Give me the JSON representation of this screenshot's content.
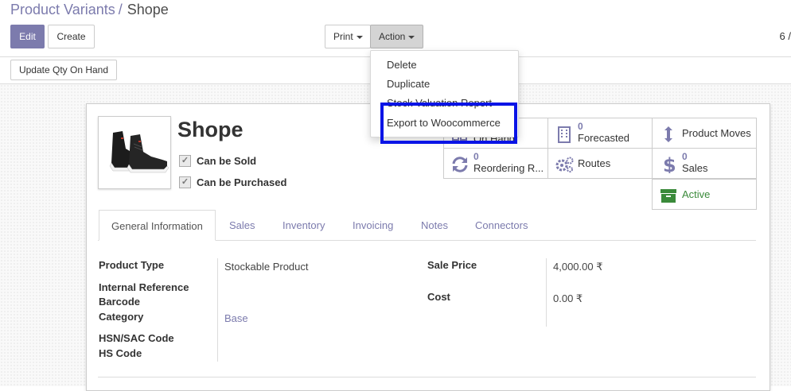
{
  "breadcrumb": {
    "parent": "Product Variants",
    "separator": "/",
    "current": "Shope"
  },
  "buttons": {
    "edit": "Edit",
    "create": "Create",
    "print": "Print",
    "action": "Action",
    "update_qty": "Update Qty On Hand"
  },
  "pager": {
    "text": "6 /"
  },
  "action_menu": {
    "items": [
      "Delete",
      "Duplicate",
      "Stock Valuation Report",
      "Export to Woocommerce"
    ],
    "highlight_color": "#0a14e6"
  },
  "product": {
    "name": "Shope",
    "can_be_sold": "Can be Sold",
    "can_be_purchased": "Can be Purchased",
    "image_icon": "sneaker-image"
  },
  "smart_buttons": {
    "on_hand": {
      "label": "On Hand",
      "icon": "cubes-icon"
    },
    "forecasted": {
      "value": "0",
      "label": "Forecasted",
      "icon": "building-icon"
    },
    "product_moves": {
      "label": "Product Moves",
      "icon": "arrows-v-icon"
    },
    "reordering": {
      "value": "0",
      "label": "Reordering R...",
      "icon": "refresh-icon"
    },
    "routes": {
      "label": "Routes",
      "icon": "cogs-icon"
    },
    "sales": {
      "value": "0",
      "label": "Sales",
      "icon": "dollar-icon"
    },
    "active": {
      "label": "Active",
      "icon": "archive-icon",
      "color": "#3a8a3a"
    }
  },
  "tabs": [
    "General Information",
    "Sales",
    "Inventory",
    "Invoicing",
    "Notes",
    "Connectors"
  ],
  "fields": {
    "product_type": {
      "label": "Product Type",
      "value": "Stockable Product"
    },
    "internal_reference": {
      "label": "Internal Reference"
    },
    "barcode": {
      "label": "Barcode"
    },
    "category": {
      "label": "Category",
      "value": "Base"
    },
    "hsn": {
      "label": "HSN/SAC Code"
    },
    "hs_code": {
      "label": "HS Code"
    },
    "sale_price": {
      "label": "Sale Price",
      "value": "4,000.00 ₹"
    },
    "cost": {
      "label": "Cost",
      "value": "0.00 ₹"
    }
  },
  "colors": {
    "brand": "#7c7bad",
    "text": "#4c4c4c"
  }
}
